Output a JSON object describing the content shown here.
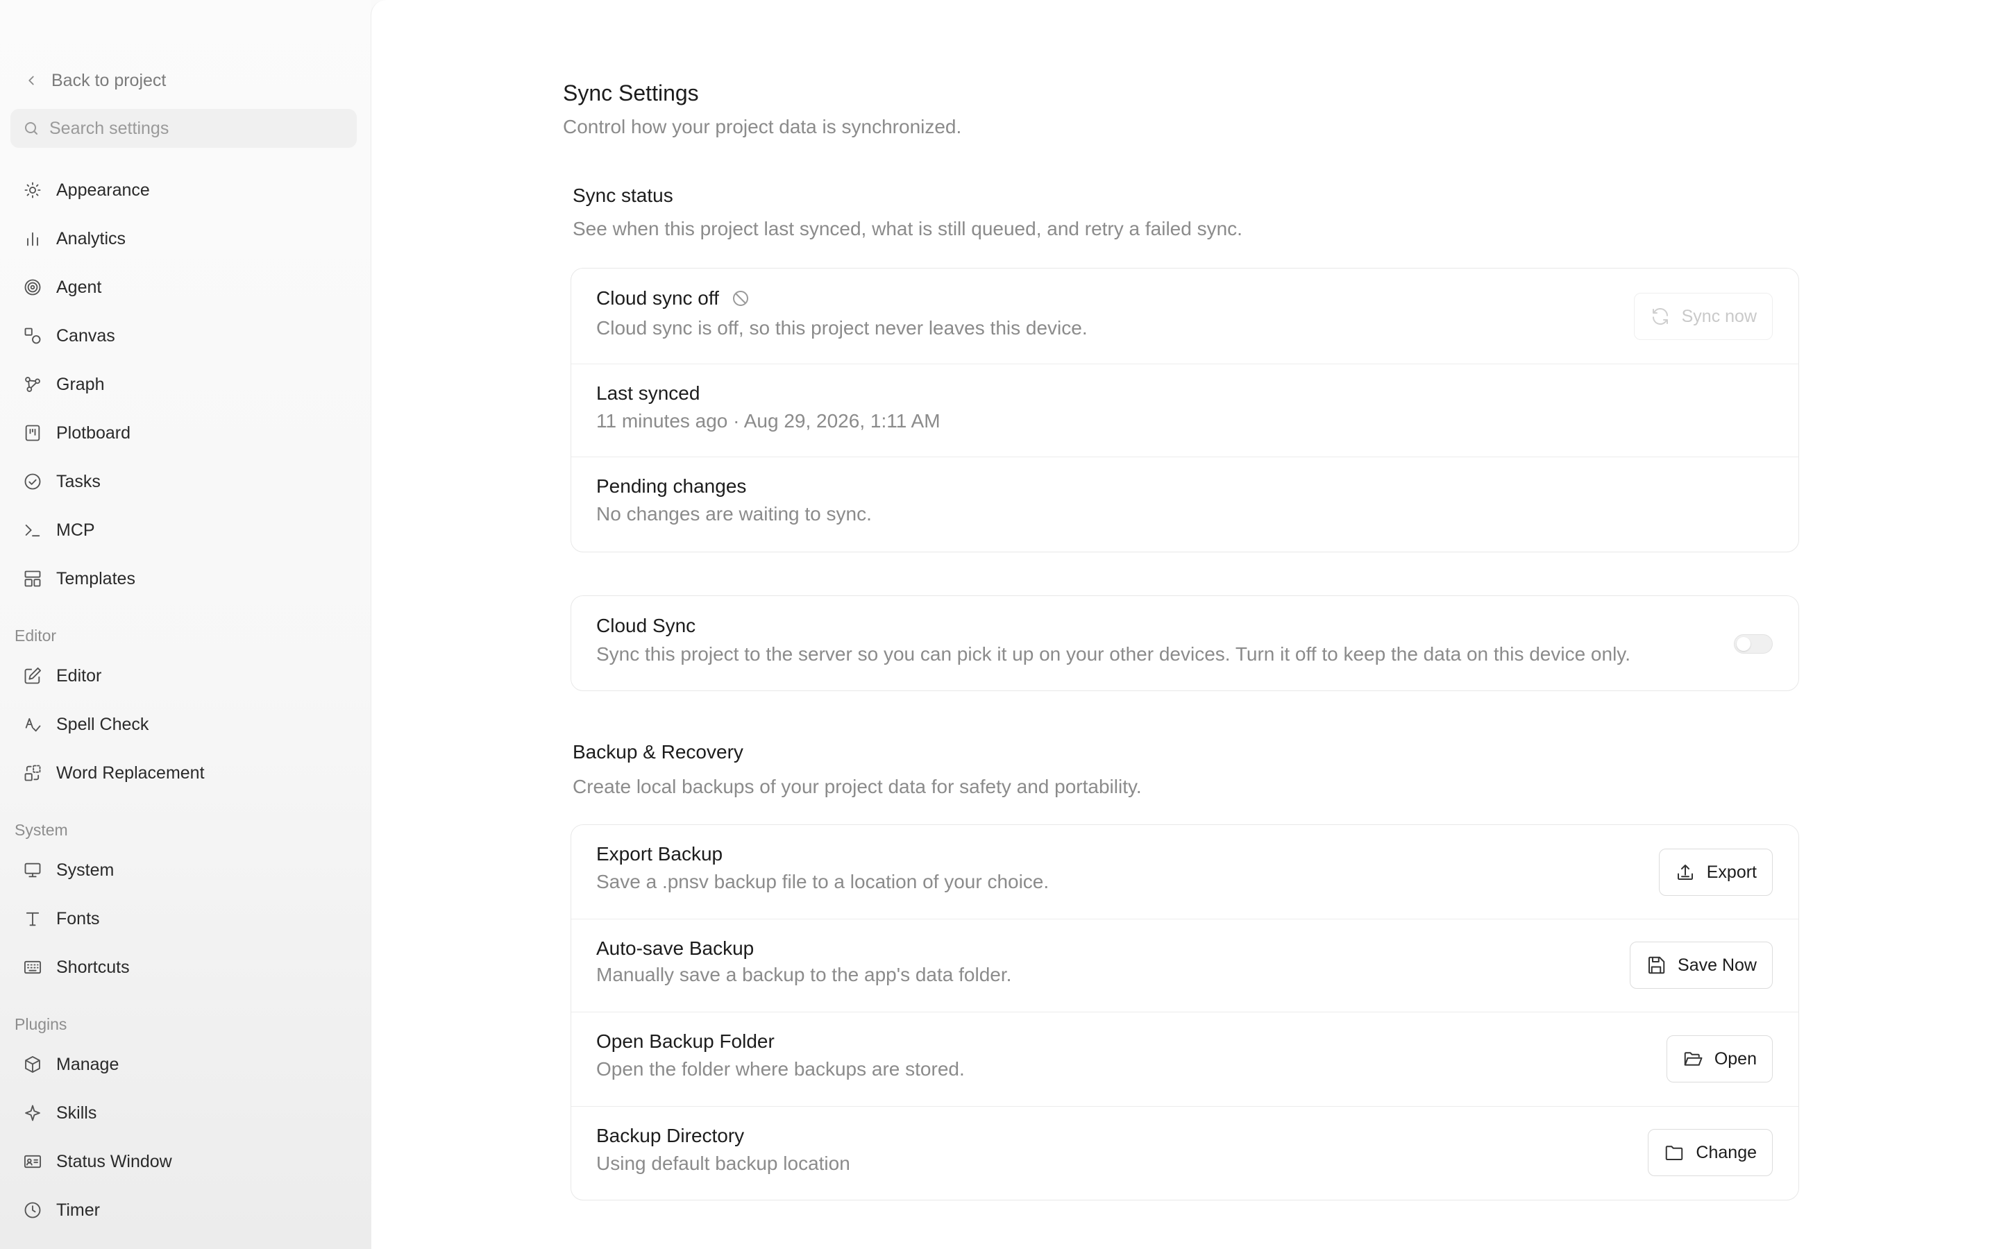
{
  "sidebar": {
    "back_label": "Back to project",
    "search_placeholder": "Search settings",
    "items": [
      {
        "label": "Appearance",
        "icon": "sun-icon"
      },
      {
        "label": "Analytics",
        "icon": "bar-chart-icon"
      },
      {
        "label": "Agent",
        "icon": "spiral-icon"
      },
      {
        "label": "Canvas",
        "icon": "shapes-icon"
      },
      {
        "label": "Graph",
        "icon": "graph-nodes-icon"
      },
      {
        "label": "Plotboard",
        "icon": "board-icon"
      },
      {
        "label": "Tasks",
        "icon": "check-circle-icon"
      },
      {
        "label": "MCP",
        "icon": "terminal-icon"
      },
      {
        "label": "Templates",
        "icon": "layout-icon"
      }
    ],
    "groups": {
      "editor": {
        "label": "Editor",
        "items": [
          {
            "label": "Editor",
            "icon": "edit-icon"
          },
          {
            "label": "Spell Check",
            "icon": "spell-check-icon"
          },
          {
            "label": "Word Replacement",
            "icon": "replace-icon"
          }
        ]
      },
      "system": {
        "label": "System",
        "items": [
          {
            "label": "System",
            "icon": "monitor-icon"
          },
          {
            "label": "Fonts",
            "icon": "type-icon"
          },
          {
            "label": "Shortcuts",
            "icon": "keyboard-icon"
          }
        ]
      },
      "plugins": {
        "label": "Plugins",
        "items": [
          {
            "label": "Manage",
            "icon": "package-icon"
          },
          {
            "label": "Skills",
            "icon": "sparkle-icon"
          },
          {
            "label": "Status Window",
            "icon": "id-card-icon"
          },
          {
            "label": "Timer",
            "icon": "clock-icon"
          }
        ]
      }
    }
  },
  "main": {
    "title": "Sync Settings",
    "subtitle": "Control how your project data is synchronized.",
    "sync_status": {
      "title": "Sync status",
      "description": "See when this project last synced, what is still queued, and retry a failed sync.",
      "cloud_off_title": "Cloud sync off",
      "cloud_off_desc": "Cloud sync is off, so this project never leaves this device.",
      "sync_now_label": "Sync now",
      "last_synced_title": "Last synced",
      "last_synced_value": "11 minutes ago · Aug 29, 2026, 1:11 AM",
      "pending_title": "Pending changes",
      "pending_value": "No changes are waiting to sync."
    },
    "cloud_sync": {
      "title": "Cloud Sync",
      "description": "Sync this project to the server so you can pick it up on your other devices. Turn it off to keep the data on this device only.",
      "enabled": false
    },
    "backup": {
      "title": "Backup & Recovery",
      "description": "Create local backups of your project data for safety and portability.",
      "rows": [
        {
          "title": "Export Backup",
          "desc": "Save a .pnsv backup file to a location of your choice.",
          "button": "Export"
        },
        {
          "title": "Auto-save Backup",
          "desc": "Manually save a backup to the app's data folder.",
          "button": "Save Now"
        },
        {
          "title": "Open Backup Folder",
          "desc": "Open the folder where backups are stored.",
          "button": "Open"
        },
        {
          "title": "Backup Directory",
          "desc": "Using default backup location",
          "button": "Change"
        }
      ]
    }
  }
}
